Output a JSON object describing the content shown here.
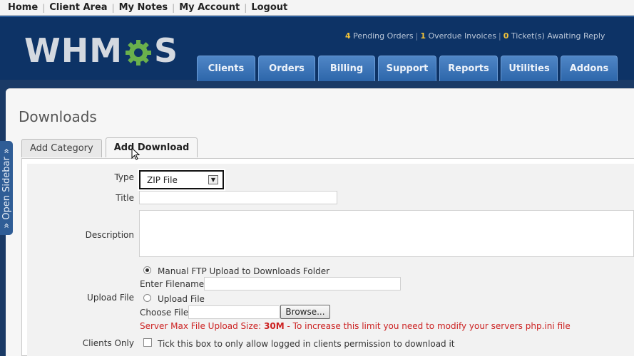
{
  "toplinks": [
    {
      "label": "Home"
    },
    {
      "label": "Client Area"
    },
    {
      "label": "My Notes"
    },
    {
      "label": "My Account"
    },
    {
      "label": "Logout"
    }
  ],
  "header": {
    "logo_prefix": "WHM",
    "logo_suffix": "S",
    "alerts": {
      "pending_count": "4",
      "pending_label": "Pending Orders",
      "overdue_count": "1",
      "overdue_label": "Overdue Invoices",
      "tickets_count": "0",
      "tickets_label": "Ticket(s) Awaiting Reply"
    },
    "nav": [
      {
        "label": "Clients"
      },
      {
        "label": "Orders"
      },
      {
        "label": "Billing"
      },
      {
        "label": "Support"
      },
      {
        "label": "Reports"
      },
      {
        "label": "Utilities"
      },
      {
        "label": "Addons"
      }
    ]
  },
  "page": {
    "title": "Downloads",
    "sidebar_label": "» Open Sidebar »",
    "tabs": [
      {
        "label": "Add Category"
      },
      {
        "label": "Add Download"
      }
    ]
  },
  "form": {
    "type_label": "Type",
    "type_value": "ZIP File",
    "title_label": "Title",
    "description_label": "Description",
    "upload_label": "Upload File",
    "option_ftp": "Manual FTP Upload to Downloads Folder",
    "enter_filename": "Enter Filename:",
    "option_upload": "Upload File",
    "choose_file": "Choose File:",
    "browse": "Browse...",
    "warn_prefix": "Server Max File Upload Size:",
    "warn_size": "30M",
    "warn_suffix": "- To increase this limit you need to modify your servers php.ini file",
    "clients_only_label": "Clients Only",
    "clients_only_text": "Tick this box to only allow logged in clients permission to download it"
  },
  "colors": {
    "header_bg": "#0d3366",
    "nav_tab": "#2d66aa",
    "alert_count": "#f2c338",
    "warning": "#cc2222"
  }
}
